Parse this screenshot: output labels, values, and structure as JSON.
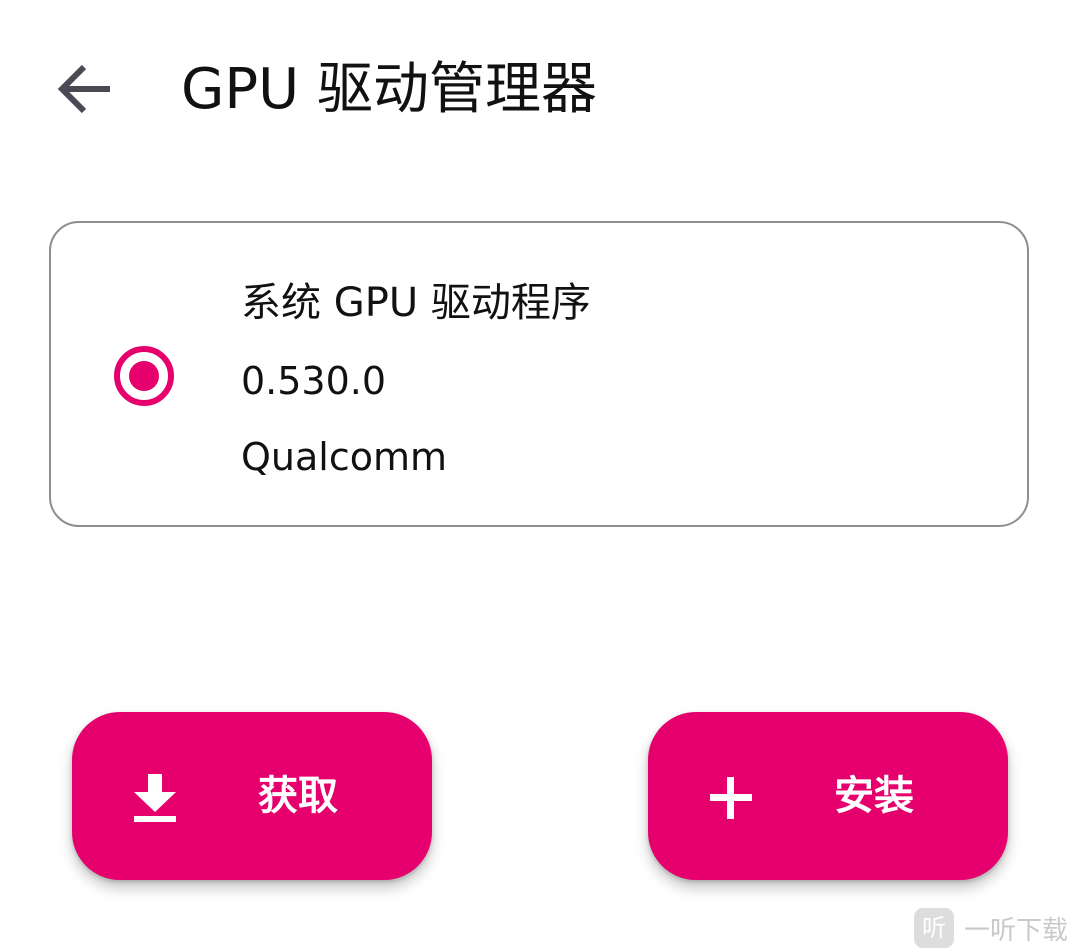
{
  "header": {
    "back_icon": "arrow-back-icon",
    "title": "GPU 驱动管理器"
  },
  "driver_card": {
    "selected": true,
    "radio_icon": "radio-selected-icon",
    "name": "系统 GPU 驱动程序",
    "version": "0.530.0",
    "vendor": "Qualcomm"
  },
  "actions": {
    "get": {
      "label": "获取",
      "icon": "download-icon"
    },
    "install": {
      "label": "安装",
      "icon": "plus-icon"
    }
  },
  "watermark": {
    "logo_glyph": "听",
    "text": "一听下载"
  },
  "colors": {
    "accent": "#e5006d",
    "radio": "#e5006d",
    "card_border": "#8f8c93",
    "text": "#111111",
    "icon": "#4a4a55"
  }
}
